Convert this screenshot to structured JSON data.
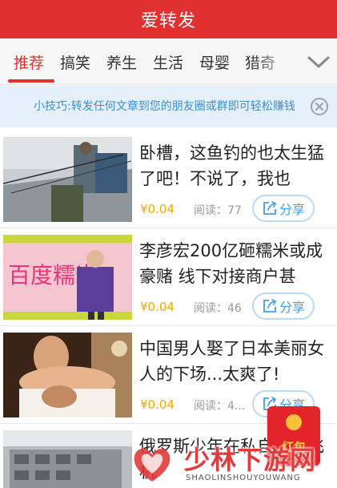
{
  "app": {
    "title": "爱转发"
  },
  "tabs": [
    {
      "label": "推荐",
      "active": true
    },
    {
      "label": "搞笑",
      "active": false
    },
    {
      "label": "养生",
      "active": false
    },
    {
      "label": "生活",
      "active": false
    },
    {
      "label": "母婴",
      "active": false
    },
    {
      "label": "猎奇",
      "active": false
    }
  ],
  "tip": {
    "text": "小技巧:转发任何文章到您的朋友圈或群即可轻松赚钱"
  },
  "share_label": "分享",
  "reads_label": "阅读：",
  "articles": [
    {
      "title": "卧槽，这鱼钓的也太生猛了吧！不说了，我也",
      "price": "¥0.04",
      "reads": "77"
    },
    {
      "title": "李彦宏200亿砸糯米或成豪赌 线下对接商户甚",
      "price": "¥0.04",
      "reads": "46"
    },
    {
      "title": "中国男人娶了日本美丽女人的下场...太爽了!",
      "price": "¥0.04",
      "reads": "4..."
    },
    {
      "title": "俄罗斯少年在私自改装飞机",
      "price": "",
      "reads": ""
    }
  ],
  "thumbnail_captions": {
    "article_2": "百度糯米"
  },
  "hongbao": {
    "label": "红包"
  },
  "watermark": {
    "main": "少林下游网",
    "sub": "SHAOLINSHOUYOUWANG"
  },
  "colors": {
    "brand_red": "#e0302f",
    "tip_blue": "#3d8fd6",
    "price_gold": "#f2a900",
    "share_blue": "#42a0e6"
  },
  "icons": {
    "tabs_more": "chevron-down-icon",
    "tip_close": "close-circle-icon",
    "share": "share-arrow-icon"
  }
}
